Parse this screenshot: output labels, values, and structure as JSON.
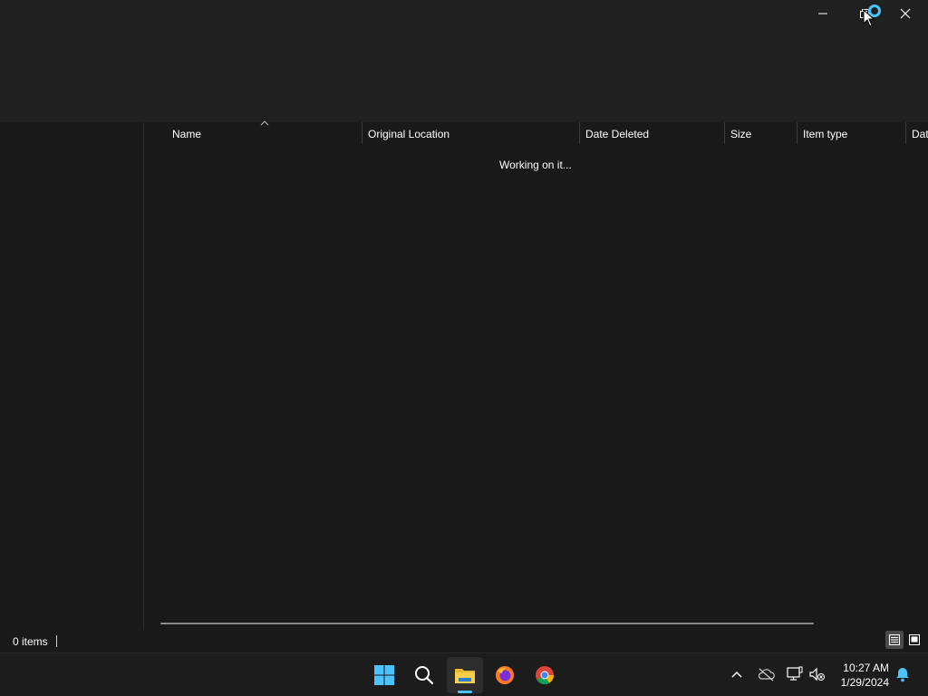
{
  "window": {
    "minimize_icon": "minimize-icon",
    "restore_icon": "restore-icon",
    "close_icon": "close-icon"
  },
  "columns": [
    {
      "label": "Name"
    },
    {
      "label": "Original Location"
    },
    {
      "label": "Date Deleted"
    },
    {
      "label": "Size"
    },
    {
      "label": "Item type"
    },
    {
      "label": "Dat"
    }
  ],
  "main": {
    "status_message": "Working on it..."
  },
  "statusbar": {
    "item_count": "0 items"
  },
  "taskbar": {
    "apps": [
      "start-icon",
      "search-icon",
      "file-explorer-icon",
      "firefox-icon",
      "chrome-icon"
    ],
    "clock_time": "10:27 AM",
    "clock_date": "1/29/2024"
  },
  "colors": {
    "accent": "#4cc2ff",
    "background": "#191919",
    "toolbar": "#202020"
  }
}
